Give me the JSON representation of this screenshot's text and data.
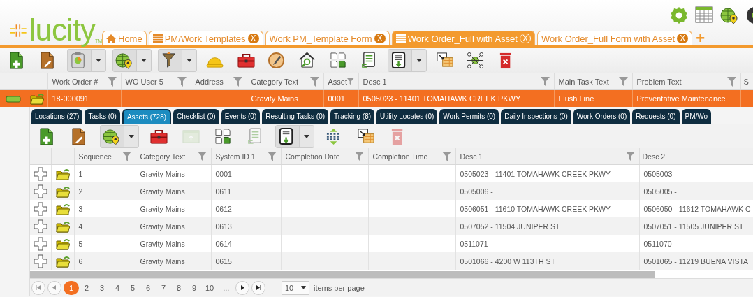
{
  "logo": {
    "name": "lucity",
    "mark": "TM"
  },
  "tabs": [
    {
      "label": "Home",
      "kind": "home",
      "selected": false
    },
    {
      "label": "PM/Work Templates",
      "kind": "list",
      "close": "X",
      "selected": false
    },
    {
      "label": "Work PM_Template Form",
      "kind": "plain",
      "close": "X",
      "selected": false
    },
    {
      "label": "Work Order_Full with Asset",
      "kind": "list",
      "close": "X",
      "selected": true
    },
    {
      "label": "Work Order_Full Form with Asset",
      "kind": "plain",
      "close": "X",
      "selected": false
    }
  ],
  "add_tab": "+",
  "toolbar": [
    {
      "kind": "new-record",
      "dropdown": false,
      "disabled": false
    },
    {
      "kind": "edit-record",
      "dropdown": false,
      "disabled": false
    },
    {
      "kind": "clipboard",
      "dropdown": true,
      "disabled": false
    },
    {
      "kind": "map",
      "dropdown": true,
      "disabled": false
    },
    {
      "kind": "filter-tool",
      "dropdown": true,
      "disabled": false
    },
    {
      "kind": "hardhat",
      "dropdown": false,
      "disabled": false
    },
    {
      "kind": "toolbox",
      "dropdown": false,
      "disabled": false
    },
    {
      "kind": "compass",
      "dropdown": false,
      "disabled": false
    },
    {
      "kind": "house-search",
      "dropdown": false,
      "disabled": false
    },
    {
      "kind": "copy",
      "dropdown": false,
      "disabled": false
    },
    {
      "kind": "form",
      "dropdown": false,
      "disabled": false
    },
    {
      "kind": "export",
      "dropdown": true,
      "disabled": false
    },
    {
      "kind": "move-grid",
      "dropdown": false,
      "disabled": false
    },
    {
      "kind": "network",
      "dropdown": false,
      "disabled": false
    },
    {
      "kind": "delete",
      "dropdown": false,
      "disabled": false
    }
  ],
  "table": {
    "columns": [
      {
        "label": "Work Order #",
        "filter": true
      },
      {
        "label": "WO User 5",
        "filter": true
      },
      {
        "label": "Address",
        "filter": true
      },
      {
        "label": "Category Text",
        "filter": true
      },
      {
        "label": "Asset",
        "filter": true
      },
      {
        "label": "Desc 1",
        "filter": true
      },
      {
        "label": "Main Task Text",
        "filter": true
      },
      {
        "label": "Problem Text",
        "filter": true
      },
      {
        "label": "S"
      }
    ],
    "rows": [
      {
        "selected": true,
        "expanded": true,
        "cells": [
          "18-000091",
          null,
          null,
          "Gravity Mains",
          "0001",
          "0505023 - 11401 TOMAHAWK CREEK PKWY",
          "Flush Line",
          "Preventative Maintenance",
          null
        ]
      }
    ]
  },
  "detail_tabs": [
    {
      "label": "Locations (27)",
      "selected": false
    },
    {
      "label": "Tasks (0)",
      "selected": false
    },
    {
      "label": "Assets (728)",
      "selected": true
    },
    {
      "label": "Checklist (0)",
      "selected": false
    },
    {
      "label": "Events (0)",
      "selected": false
    },
    {
      "label": "Resulting Tasks (0)",
      "selected": false
    },
    {
      "label": "Tracking (8)",
      "selected": false
    },
    {
      "label": "Utility Locates (0)",
      "selected": false
    },
    {
      "label": "Work Permits (0)",
      "selected": false
    },
    {
      "label": "Daily Inspections (0)",
      "selected": false
    },
    {
      "label": "Work Orders (0)",
      "selected": false
    },
    {
      "label": "Requests (0)",
      "selected": false
    },
    {
      "label": "PM/Wo",
      "selected": false
    }
  ],
  "detail_toolbar": [
    {
      "kind": "new-record",
      "dropdown": false,
      "disabled": false
    },
    {
      "kind": "edit-record",
      "dropdown": false,
      "disabled": false
    },
    {
      "kind": "map",
      "dropdown": true,
      "disabled": false
    },
    {
      "kind": "toolbox",
      "dropdown": false,
      "disabled": false
    },
    {
      "kind": "window",
      "dropdown": false,
      "disabled": true
    },
    {
      "kind": "copy",
      "dropdown": false,
      "disabled": false
    },
    {
      "kind": "form",
      "dropdown": false,
      "disabled": true
    },
    {
      "kind": "export",
      "dropdown": true,
      "disabled": false
    },
    {
      "kind": "reorder",
      "dropdown": false,
      "disabled": false
    },
    {
      "kind": "move-grid",
      "dropdown": false,
      "disabled": false
    },
    {
      "kind": "delete",
      "dropdown": false,
      "disabled": true
    }
  ],
  "detail_table": {
    "columns": [
      {
        "label": "Sequence",
        "filter": true
      },
      {
        "label": "Category Text",
        "filter": true
      },
      {
        "label": "System ID 1",
        "filter": true
      },
      {
        "label": "Completion Date",
        "filter": true
      },
      {
        "label": "Completion Time",
        "filter": true
      },
      {
        "label": "Desc 1",
        "filter": true
      },
      {
        "label": "Desc 2"
      }
    ],
    "rows": [
      {
        "selected": false,
        "expanded": false,
        "cells": [
          "1",
          "Gravity Mains",
          "0001",
          null,
          null,
          "0505023 - 11401 TOMAHAWK CREEK PKWY",
          "0505003 -"
        ]
      },
      {
        "selected": false,
        "expanded": false,
        "cells": [
          "2",
          "Gravity Mains",
          "0611",
          null,
          null,
          "0505006 -",
          "0505005 -"
        ]
      },
      {
        "selected": false,
        "expanded": false,
        "cells": [
          "3",
          "Gravity Mains",
          "0612",
          null,
          null,
          "0506051 - 11610 TOMAHAWK CREEK PKWY",
          "0506050 - 11612 TOMAHAWK C"
        ]
      },
      {
        "selected": false,
        "expanded": false,
        "cells": [
          "4",
          "Gravity Mains",
          "0613",
          null,
          null,
          "0507052 - 11504 JUNIPER ST",
          "0507051 - 11505 JUNIPER ST"
        ]
      },
      {
        "selected": false,
        "expanded": false,
        "cells": [
          "5",
          "Gravity Mains",
          "0614",
          null,
          null,
          "0511071 -",
          "0511070 -"
        ]
      },
      {
        "selected": false,
        "expanded": false,
        "cells": [
          "6",
          "Gravity Mains",
          "0615",
          null,
          null,
          "0501066 - 4200 W 113TH ST",
          "0501065 - 11219 BUENA VISTA"
        ]
      }
    ]
  },
  "pager": {
    "pages": [
      {
        "label": "1",
        "selected": true
      },
      {
        "label": "2",
        "selected": false
      },
      {
        "label": "3",
        "selected": false
      },
      {
        "label": "4",
        "selected": false
      },
      {
        "label": "5",
        "selected": false
      },
      {
        "label": "6",
        "selected": false
      },
      {
        "label": "7",
        "selected": false
      },
      {
        "label": "8",
        "selected": false
      },
      {
        "label": "9",
        "selected": false
      },
      {
        "label": "10",
        "selected": false
      }
    ],
    "more": "...",
    "page_size": "10",
    "page_size_label": "items per page"
  }
}
